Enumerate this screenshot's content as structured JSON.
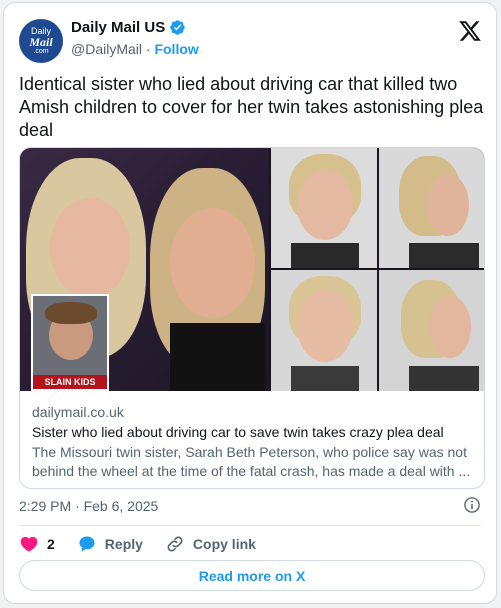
{
  "account": {
    "name": "Daily Mail US",
    "handle": "@DailyMail",
    "separator": "·",
    "follow_label": "Follow",
    "avatar_text": [
      "Daily",
      "Mail",
      ".com"
    ],
    "verified_icon": "verified-badge-icon",
    "brand_icon": "x-logo-icon"
  },
  "tweet": {
    "text": "Identical sister who lied about driving car that killed two Amish children to cover for her twin takes astonishing plea deal"
  },
  "link_card": {
    "image_overlay_text": "SLAIN KIDS",
    "domain": "dailymail.co.uk",
    "title": "Sister who lied about driving car to save twin takes crazy plea deal",
    "description": "The Missouri twin sister, Sarah Beth Peterson, who police say was not behind the wheel at the time of the fatal crash, has made a deal with ..."
  },
  "meta": {
    "timestamp": "2:29 PM · Feb 6, 2025",
    "info_icon": "info-icon"
  },
  "actions": {
    "like_count": "2",
    "reply_label": "Reply",
    "copy_label": "Copy link"
  },
  "read_more_label": "Read more on X",
  "colors": {
    "accent": "#1d9bf0",
    "like": "#f91880",
    "text": "#0f1419",
    "secondary_text": "#536471",
    "border": "#cfd9de"
  }
}
